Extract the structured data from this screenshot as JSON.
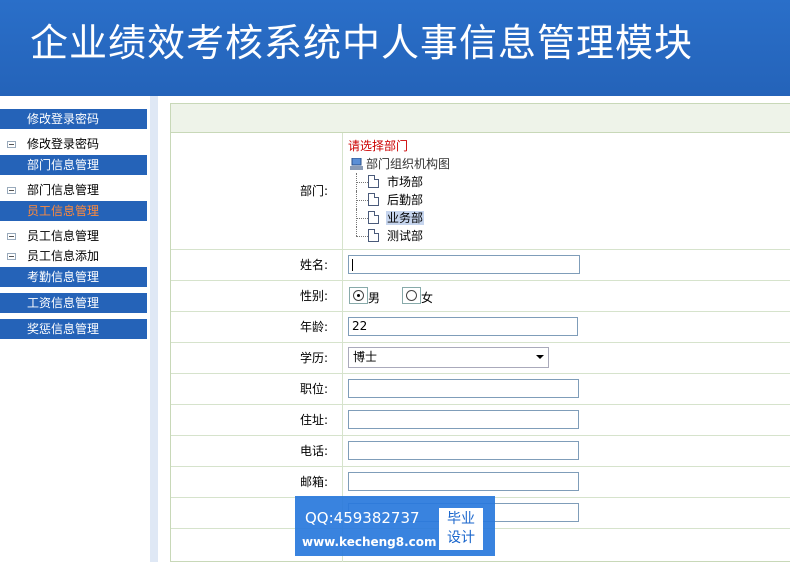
{
  "header": {
    "title": "企业绩效考核系统中人事信息管理模块"
  },
  "sidebar": {
    "sections": [
      {
        "label": "修改登录密码",
        "items": [
          "修改登录密码"
        ]
      },
      {
        "label": "部门信息管理",
        "items": [
          "部门信息管理"
        ]
      },
      {
        "label": "员工信息管理",
        "items": [
          "员工信息管理",
          "员工信息添加"
        ],
        "active": true
      },
      {
        "label": "考勤信息管理",
        "items": []
      },
      {
        "label": "工资信息管理",
        "items": []
      },
      {
        "label": "奖惩信息管理",
        "items": []
      }
    ]
  },
  "form": {
    "department": {
      "label": "部门:",
      "prompt": "请选择部门",
      "root": "部门组织机构图",
      "nodes": [
        "市场部",
        "后勤部",
        "业务部",
        "测试部"
      ],
      "selected": "业务部"
    },
    "name": {
      "label": "姓名:",
      "value": ""
    },
    "gender": {
      "label": "性别:",
      "options": [
        "男",
        "女"
      ],
      "selected": "男"
    },
    "age": {
      "label": "年龄:",
      "value": "22"
    },
    "education": {
      "label": "学历:",
      "selected": "博士"
    },
    "position": {
      "label": "职位:",
      "value": ""
    },
    "address": {
      "label": "住址:",
      "value": ""
    },
    "phone": {
      "label": "电话:",
      "value": ""
    },
    "email": {
      "label": "邮箱:",
      "value": ""
    }
  },
  "watermark": {
    "qq": "QQ:459382737",
    "url": "www.kecheng8.com",
    "badge_line1": "毕业",
    "badge_line2": "设计"
  }
}
